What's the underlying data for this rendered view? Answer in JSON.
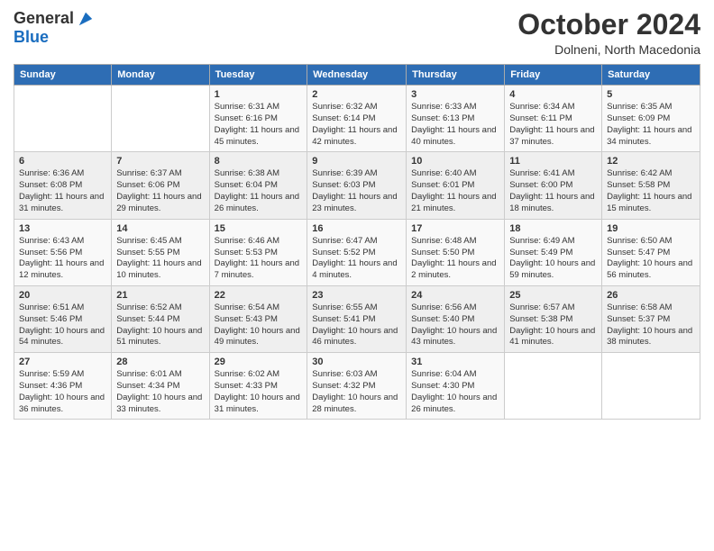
{
  "header": {
    "logo_general": "General",
    "logo_blue": "Blue",
    "month_title": "October 2024",
    "location": "Dolneni, North Macedonia"
  },
  "weekdays": [
    "Sunday",
    "Monday",
    "Tuesday",
    "Wednesday",
    "Thursday",
    "Friday",
    "Saturday"
  ],
  "weeks": [
    [
      {
        "day": "",
        "info": ""
      },
      {
        "day": "",
        "info": ""
      },
      {
        "day": "1",
        "info": "Sunrise: 6:31 AM\nSunset: 6:16 PM\nDaylight: 11 hours and 45 minutes."
      },
      {
        "day": "2",
        "info": "Sunrise: 6:32 AM\nSunset: 6:14 PM\nDaylight: 11 hours and 42 minutes."
      },
      {
        "day": "3",
        "info": "Sunrise: 6:33 AM\nSunset: 6:13 PM\nDaylight: 11 hours and 40 minutes."
      },
      {
        "day": "4",
        "info": "Sunrise: 6:34 AM\nSunset: 6:11 PM\nDaylight: 11 hours and 37 minutes."
      },
      {
        "day": "5",
        "info": "Sunrise: 6:35 AM\nSunset: 6:09 PM\nDaylight: 11 hours and 34 minutes."
      }
    ],
    [
      {
        "day": "6",
        "info": "Sunrise: 6:36 AM\nSunset: 6:08 PM\nDaylight: 11 hours and 31 minutes."
      },
      {
        "day": "7",
        "info": "Sunrise: 6:37 AM\nSunset: 6:06 PM\nDaylight: 11 hours and 29 minutes."
      },
      {
        "day": "8",
        "info": "Sunrise: 6:38 AM\nSunset: 6:04 PM\nDaylight: 11 hours and 26 minutes."
      },
      {
        "day": "9",
        "info": "Sunrise: 6:39 AM\nSunset: 6:03 PM\nDaylight: 11 hours and 23 minutes."
      },
      {
        "day": "10",
        "info": "Sunrise: 6:40 AM\nSunset: 6:01 PM\nDaylight: 11 hours and 21 minutes."
      },
      {
        "day": "11",
        "info": "Sunrise: 6:41 AM\nSunset: 6:00 PM\nDaylight: 11 hours and 18 minutes."
      },
      {
        "day": "12",
        "info": "Sunrise: 6:42 AM\nSunset: 5:58 PM\nDaylight: 11 hours and 15 minutes."
      }
    ],
    [
      {
        "day": "13",
        "info": "Sunrise: 6:43 AM\nSunset: 5:56 PM\nDaylight: 11 hours and 12 minutes."
      },
      {
        "day": "14",
        "info": "Sunrise: 6:45 AM\nSunset: 5:55 PM\nDaylight: 11 hours and 10 minutes."
      },
      {
        "day": "15",
        "info": "Sunrise: 6:46 AM\nSunset: 5:53 PM\nDaylight: 11 hours and 7 minutes."
      },
      {
        "day": "16",
        "info": "Sunrise: 6:47 AM\nSunset: 5:52 PM\nDaylight: 11 hours and 4 minutes."
      },
      {
        "day": "17",
        "info": "Sunrise: 6:48 AM\nSunset: 5:50 PM\nDaylight: 11 hours and 2 minutes."
      },
      {
        "day": "18",
        "info": "Sunrise: 6:49 AM\nSunset: 5:49 PM\nDaylight: 10 hours and 59 minutes."
      },
      {
        "day": "19",
        "info": "Sunrise: 6:50 AM\nSunset: 5:47 PM\nDaylight: 10 hours and 56 minutes."
      }
    ],
    [
      {
        "day": "20",
        "info": "Sunrise: 6:51 AM\nSunset: 5:46 PM\nDaylight: 10 hours and 54 minutes."
      },
      {
        "day": "21",
        "info": "Sunrise: 6:52 AM\nSunset: 5:44 PM\nDaylight: 10 hours and 51 minutes."
      },
      {
        "day": "22",
        "info": "Sunrise: 6:54 AM\nSunset: 5:43 PM\nDaylight: 10 hours and 49 minutes."
      },
      {
        "day": "23",
        "info": "Sunrise: 6:55 AM\nSunset: 5:41 PM\nDaylight: 10 hours and 46 minutes."
      },
      {
        "day": "24",
        "info": "Sunrise: 6:56 AM\nSunset: 5:40 PM\nDaylight: 10 hours and 43 minutes."
      },
      {
        "day": "25",
        "info": "Sunrise: 6:57 AM\nSunset: 5:38 PM\nDaylight: 10 hours and 41 minutes."
      },
      {
        "day": "26",
        "info": "Sunrise: 6:58 AM\nSunset: 5:37 PM\nDaylight: 10 hours and 38 minutes."
      }
    ],
    [
      {
        "day": "27",
        "info": "Sunrise: 5:59 AM\nSunset: 4:36 PM\nDaylight: 10 hours and 36 minutes."
      },
      {
        "day": "28",
        "info": "Sunrise: 6:01 AM\nSunset: 4:34 PM\nDaylight: 10 hours and 33 minutes."
      },
      {
        "day": "29",
        "info": "Sunrise: 6:02 AM\nSunset: 4:33 PM\nDaylight: 10 hours and 31 minutes."
      },
      {
        "day": "30",
        "info": "Sunrise: 6:03 AM\nSunset: 4:32 PM\nDaylight: 10 hours and 28 minutes."
      },
      {
        "day": "31",
        "info": "Sunrise: 6:04 AM\nSunset: 4:30 PM\nDaylight: 10 hours and 26 minutes."
      },
      {
        "day": "",
        "info": ""
      },
      {
        "day": "",
        "info": ""
      }
    ]
  ]
}
